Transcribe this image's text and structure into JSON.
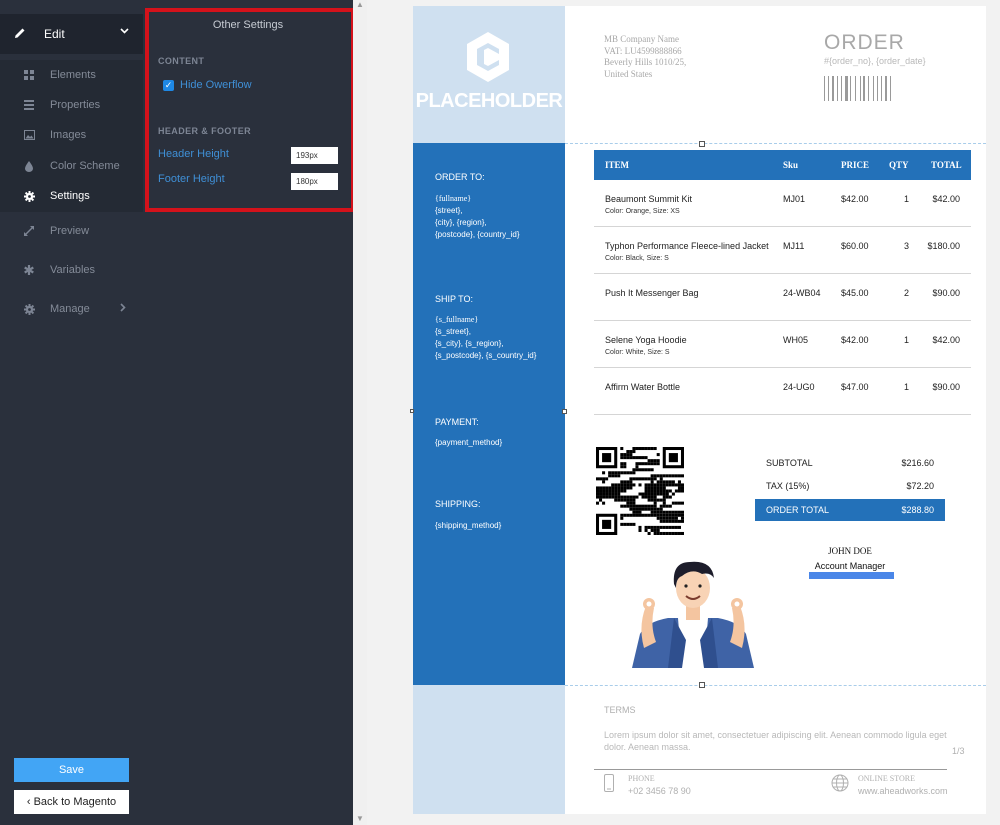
{
  "nav": {
    "edit_label": "Edit",
    "items": [
      {
        "label": "Elements",
        "icon": "grid-icon"
      },
      {
        "label": "Properties",
        "icon": "list-icon"
      },
      {
        "label": "Images",
        "icon": "image-icon"
      },
      {
        "label": "Color Scheme",
        "icon": "droplet-icon"
      },
      {
        "label": "Settings",
        "icon": "gear-icon"
      },
      {
        "label": "Preview",
        "icon": "expand-icon"
      },
      {
        "label": "Variables",
        "icon": "asterisk-icon"
      },
      {
        "label": "Manage",
        "icon": "gear-icon"
      }
    ],
    "save_label": "Save",
    "back_label": "Back to Magento"
  },
  "panel": {
    "title": "Other Settings",
    "content_heading": "CONTENT",
    "hide_overflow_label": "Hide Owerflow",
    "hide_overflow_checked": true,
    "header_footer_heading": "HEADER & FOOTER",
    "header_height_label": "Header Height",
    "header_height_value": "193px",
    "footer_height_label": "Footer Height",
    "footer_height_value": "180px"
  },
  "document": {
    "logo_text": "PLACEHOLDER",
    "company_lines": [
      "MB Company Name",
      "VAT: LU4599888866",
      "Beverly Hills 1010/25,",
      "United States"
    ],
    "order_title": "ORDER",
    "order_sub": "#{order_no}, {order_date}",
    "order_to": {
      "heading": "ORDER TO:",
      "l1": "{fullname}",
      "l2": "{street},",
      "l3": "{city}, {region},",
      "l4": "{postcode}, {country_id}"
    },
    "ship_to": {
      "heading": "SHIP TO:",
      "l1": "{s_fullname}",
      "l2": "{s_street},",
      "l3": "{s_city}, {s_region},",
      "l4": "{s_postcode}, {s_country_id}"
    },
    "payment": {
      "heading": "PAYMENT:",
      "value": "{payment_method}"
    },
    "shipping": {
      "heading": "SHIPPING:",
      "value": "{shipping_method}"
    },
    "table": {
      "headers": [
        "ITEM",
        "Sku",
        "PRICE",
        "QTY",
        "TOTAL"
      ],
      "rows": [
        {
          "item": "Beaumont Summit Kit",
          "options": "Color: Orange, Size: XS",
          "sku": "MJ01",
          "price": "$42.00",
          "qty": "1",
          "total": "$42.00"
        },
        {
          "item": "Typhon Performance Fleece-lined Jacket",
          "options": "Color: Black, Size: S",
          "sku": "MJ11",
          "price": "$60.00",
          "qty": "3",
          "total": "$180.00"
        },
        {
          "item": "Push It Messenger Bag",
          "options": "",
          "sku": "24-WB04",
          "price": "$45.00",
          "qty": "2",
          "total": "$90.00"
        },
        {
          "item": "Selene Yoga Hoodie",
          "options": "Color: White, Size: S",
          "sku": "WH05",
          "price": "$42.00",
          "qty": "1",
          "total": "$42.00"
        },
        {
          "item": "Affirm Water Bottle",
          "options": "",
          "sku": "24-UG0",
          "price": "$47.00",
          "qty": "1",
          "total": "$90.00"
        }
      ]
    },
    "totals": {
      "subtotal_label": "SUBTOTAL",
      "subtotal_value": "$216.60",
      "tax_label": "TAX (15%)",
      "tax_value": "$72.20",
      "order_total_label": "ORDER TOTAL",
      "order_total_value": "$288.80"
    },
    "signature": {
      "name": "JOHN DOE",
      "role": "Account Manager"
    },
    "terms_heading": "TERMS",
    "terms_text": "Lorem ipsum dolor sit amet, consectetuer adipiscing elit. Aenean commodo ligula eget dolor. Aenean massa.",
    "page_number": "1/3",
    "phone_label": "PHONE",
    "phone_value": "+02 3456 78 90",
    "store_label": "ONLINE STORE",
    "store_value": "www.aheadworks.com"
  },
  "colors": {
    "accent": "#2371b9",
    "light_band": "#cfe0f0",
    "nav_bg": "#2a303c",
    "highlight": "#d4121b",
    "save": "#42a5f5"
  }
}
